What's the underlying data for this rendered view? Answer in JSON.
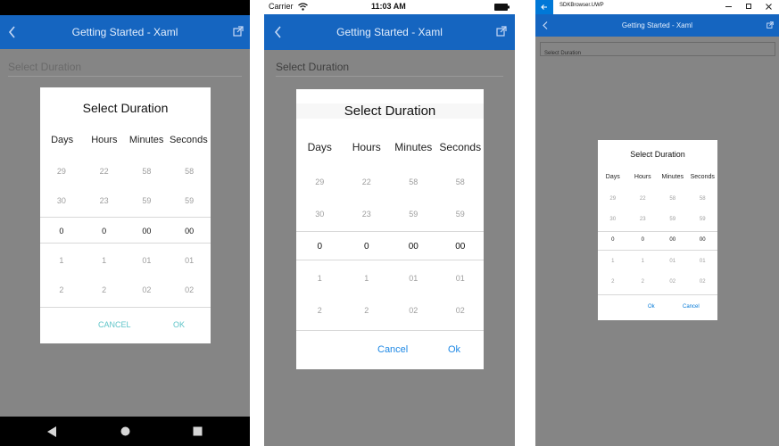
{
  "colors": {
    "appbar": "#1565c0",
    "overlay": "#858585",
    "android_accent": "#5ec4c8",
    "ios_accent": "#1e88e5",
    "uwp_accent": "#0078d7",
    "navbar": "#000000"
  },
  "app": {
    "title": "Getting Started - Xaml",
    "field_placeholder": "Select Duration"
  },
  "ios_status": {
    "carrier": "Carrier",
    "time": "11:03 AM"
  },
  "uwp_window": {
    "title": "SDKBrowser.UWP"
  },
  "dialog": {
    "title": "Select Duration",
    "columns": [
      "Days",
      "Hours",
      "Minutes",
      "Seconds"
    ],
    "rows": [
      [
        "29",
        "22",
        "58",
        "58"
      ],
      [
        "30",
        "23",
        "59",
        "59"
      ],
      [
        "0",
        "0",
        "00",
        "00"
      ],
      [
        "1",
        "1",
        "01",
        "01"
      ],
      [
        "2",
        "2",
        "02",
        "02"
      ]
    ],
    "selected_row": 2
  },
  "android": {
    "cancel": "CANCEL",
    "ok": "OK"
  },
  "ios": {
    "cancel": "Cancel",
    "ok": "Ok"
  },
  "uwp": {
    "ok": "Ok",
    "cancel": "Cancel"
  },
  "icons": {
    "back": "back-arrow-icon",
    "external": "open-external-icon",
    "wifi": "wifi-icon",
    "battery": "battery-icon",
    "nav_back": "nav-back-icon",
    "nav_home": "nav-home-icon",
    "nav_recents": "nav-recents-icon"
  }
}
